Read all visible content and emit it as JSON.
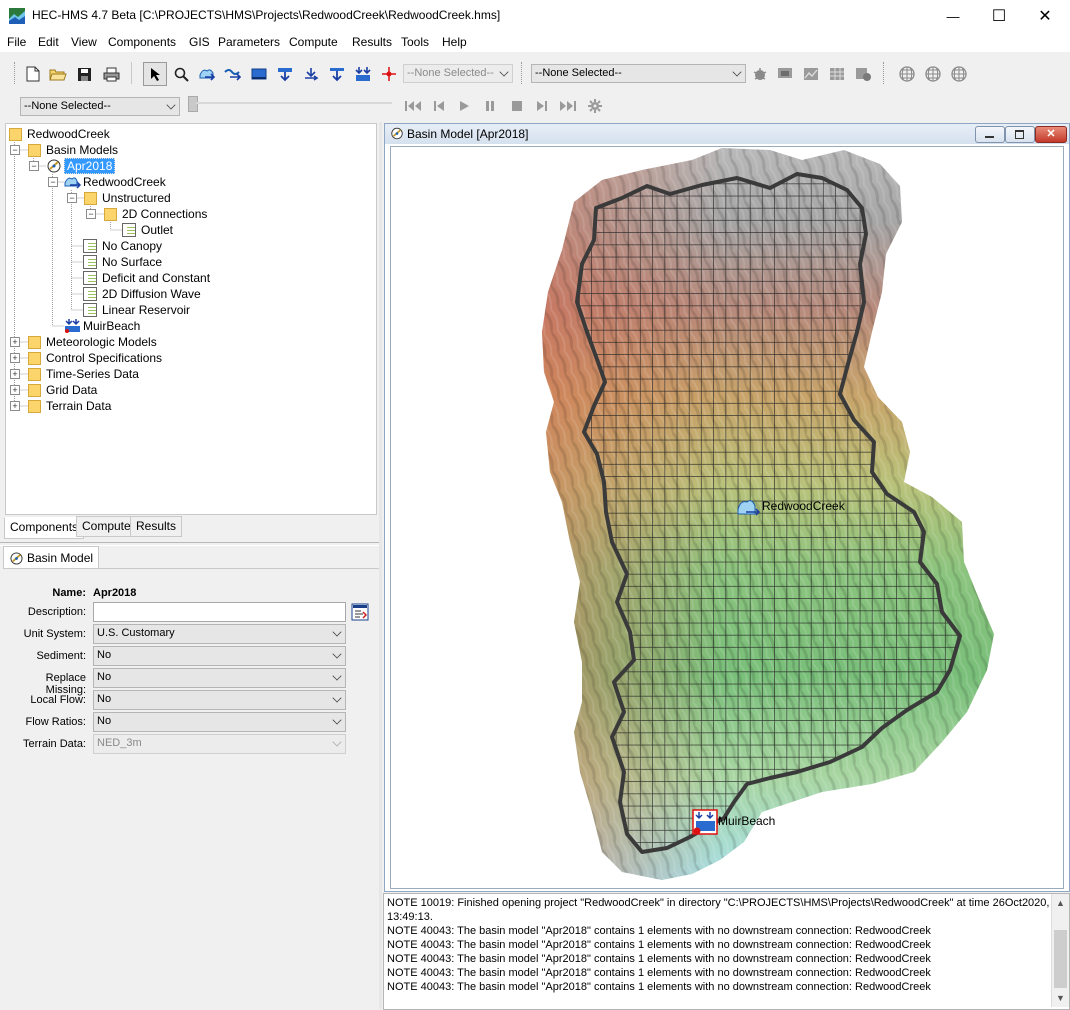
{
  "window": {
    "title": "HEC-HMS 4.7 Beta [C:\\PROJECTS\\HMS\\Projects\\RedwoodCreek\\RedwoodCreek.hms]",
    "minimize": "—",
    "maximize": "☐",
    "close": "✕"
  },
  "menu": [
    "File",
    "Edit",
    "View",
    "Components",
    "GIS",
    "Parameters",
    "Compute",
    "Results",
    "Tools",
    "Help"
  ],
  "toolbar": {
    "element_combo": "--None Selected--",
    "run_combo": "--None Selected--",
    "animation_combo": "--None Selected--"
  },
  "tree": {
    "root": "RedwoodCreek",
    "basin_models": "Basin Models",
    "apr2018": "Apr2018",
    "redwoodcreek": "RedwoodCreek",
    "unstructured": "Unstructured",
    "connections": "2D Connections",
    "outlet": "Outlet",
    "no_canopy": "No Canopy",
    "no_surface": "No Surface",
    "deficit": "Deficit and Constant",
    "diffusion": "2D Diffusion Wave",
    "reservoir": "Linear Reservoir",
    "muirbeach": "MuirBeach",
    "met_models": "Meteorologic Models",
    "control_specs": "Control Specifications",
    "ts_data": "Time-Series Data",
    "grid_data": "Grid Data",
    "terrain_data": "Terrain Data"
  },
  "tabs": {
    "components": "Components",
    "compute": "Compute",
    "results": "Results"
  },
  "properties": {
    "tab": "Basin Model",
    "name_label": "Name:",
    "name_value": "Apr2018",
    "description_label": "Description:",
    "description_value": "",
    "unit_system_label": "Unit System:",
    "unit_system_value": "U.S. Customary",
    "sediment_label": "Sediment:",
    "sediment_value": "No",
    "replace_missing_label": "Replace Missing:",
    "replace_missing_value": "No",
    "local_flow_label": "Local Flow:",
    "local_flow_value": "No",
    "flow_ratios_label": "Flow Ratios:",
    "flow_ratios_value": "No",
    "terrain_data_label": "Terrain Data:",
    "terrain_data_value": "NED_3m"
  },
  "map": {
    "title": "Basin Model [Apr2018]",
    "subbasin_label": "RedwoodCreek",
    "sink_label": "MuirBeach"
  },
  "log": [
    "NOTE 10019:  Finished opening project \"RedwoodCreek\" in directory \"C:\\PROJECTS\\HMS\\Projects\\RedwoodCreek\" at time 26Oct2020,",
    "13:49:13.",
    "NOTE 40043:  The basin model \"Apr2018\" contains 1 elements with no downstream connection: RedwoodCreek",
    "NOTE 40043:  The basin model \"Apr2018\" contains 1 elements with no downstream connection: RedwoodCreek",
    "NOTE 40043:  The basin model \"Apr2018\" contains 1 elements with no downstream connection: RedwoodCreek",
    "NOTE 40043:  The basin model \"Apr2018\" contains 1 elements with no downstream connection: RedwoodCreek",
    "NOTE 40043:  The basin model \"Apr2018\" contains 1 elements with no downstream connection: RedwoodCreek"
  ]
}
